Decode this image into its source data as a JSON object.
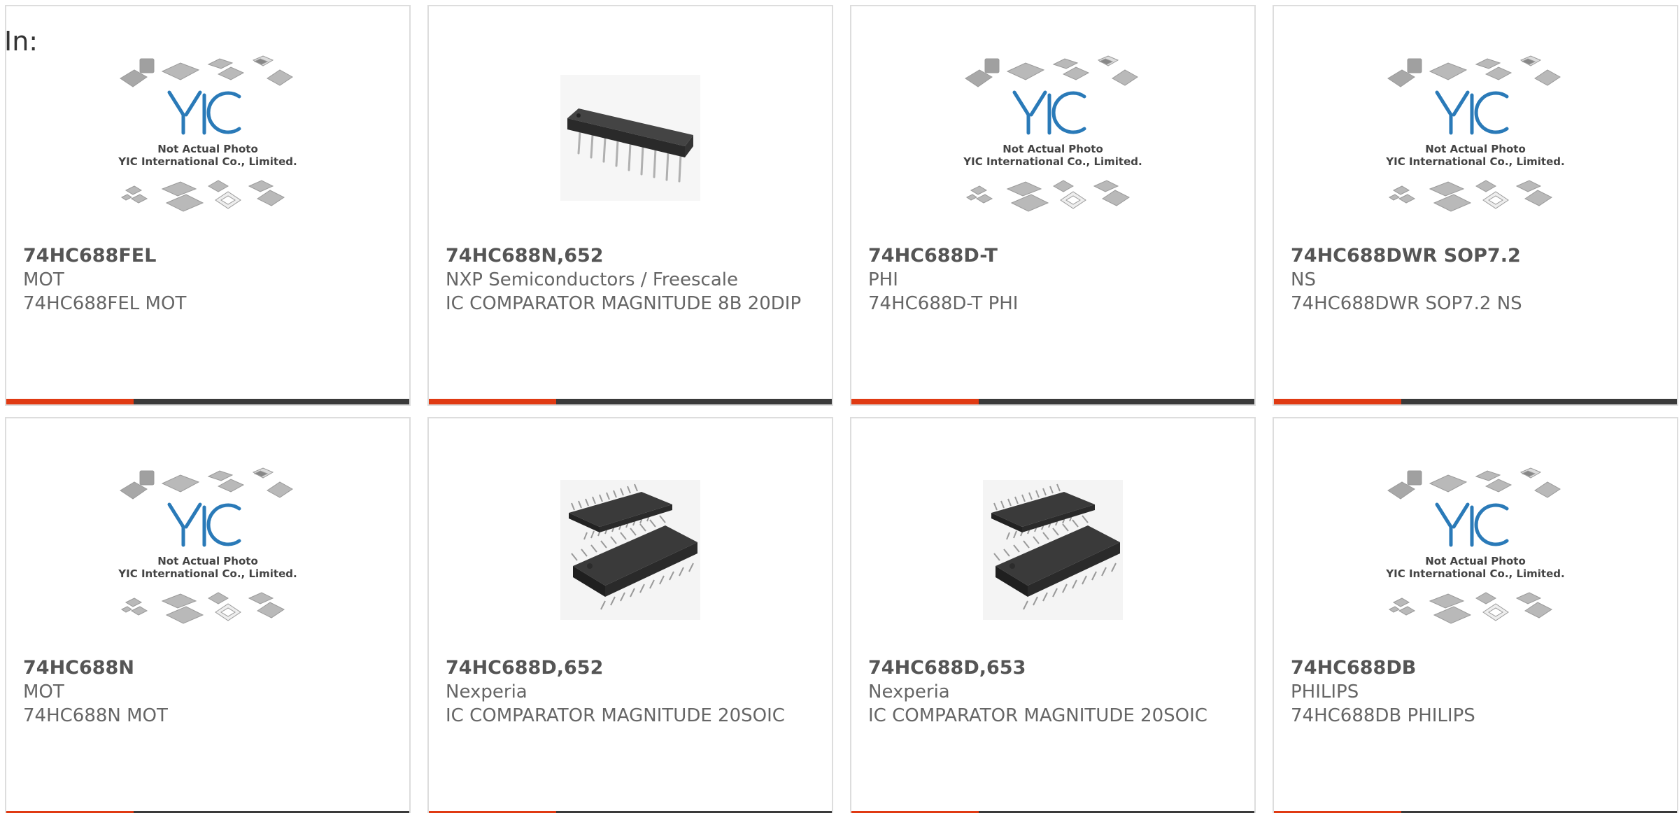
{
  "header": {
    "label": "In:"
  },
  "theme": {
    "accent": "#e03a13",
    "bar": "#3a3a3a",
    "text": "#666666"
  },
  "placeholder": {
    "logo": "YIC",
    "line1": "Not Actual Photo",
    "line2": "YIC International Co., Limited."
  },
  "products": [
    {
      "part": "74HC688FEL",
      "brand": "MOT",
      "desc": "74HC688FEL MOT",
      "image": "placeholder-icon"
    },
    {
      "part": "74HC688N,652",
      "brand": "NXP Semiconductors / Freescale",
      "desc": "IC COMPARATOR MAGNITUDE 8B 20DIP",
      "image": "dip-chip-icon"
    },
    {
      "part": "74HC688D-T",
      "brand": "PHI",
      "desc": "74HC688D-T PHI",
      "image": "placeholder-icon"
    },
    {
      "part": "74HC688DWR SOP7.2",
      "brand": "NS",
      "desc": "74HC688DWR SOP7.2 NS",
      "image": "placeholder-icon"
    },
    {
      "part": "74HC688N",
      "brand": "MOT",
      "desc": "74HC688N MOT",
      "image": "placeholder-icon"
    },
    {
      "part": "74HC688D,652",
      "brand": "Nexperia",
      "desc": "IC COMPARATOR MAGNITUDE 20SOIC",
      "image": "soic-chip-icon"
    },
    {
      "part": "74HC688D,653",
      "brand": "Nexperia",
      "desc": "IC COMPARATOR MAGNITUDE 20SOIC",
      "image": "soic-chip-icon"
    },
    {
      "part": "74HC688DB",
      "brand": "PHILIPS",
      "desc": "74HC688DB PHILIPS",
      "image": "placeholder-icon"
    }
  ]
}
